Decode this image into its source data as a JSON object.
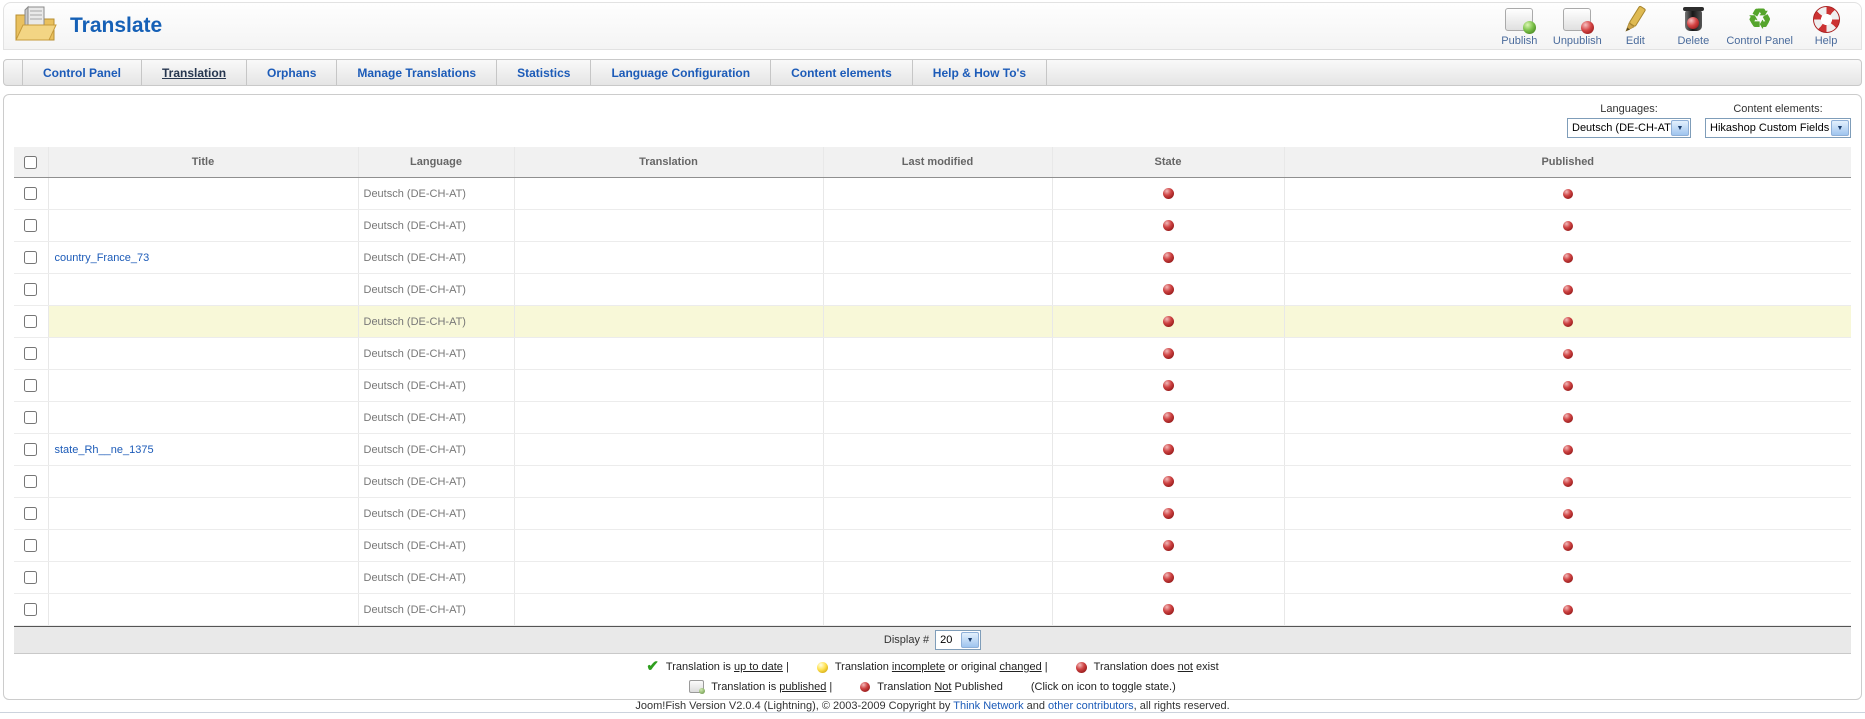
{
  "window": {
    "title": "Translate"
  },
  "toolbar": {
    "buttons": [
      {
        "label": "Publish",
        "icon": "publish-icon"
      },
      {
        "label": "Unpublish",
        "icon": "unpublish-icon"
      },
      {
        "label": "Edit",
        "icon": "edit-icon"
      },
      {
        "label": "Delete",
        "icon": "delete-icon"
      },
      {
        "label": "Control Panel",
        "icon": "control-panel-icon"
      },
      {
        "label": "Help",
        "icon": "help-icon"
      }
    ]
  },
  "tabs": [
    {
      "label": "Control Panel",
      "active": false
    },
    {
      "label": "Translation",
      "active": true
    },
    {
      "label": "Orphans",
      "active": false
    },
    {
      "label": "Manage Translations",
      "active": false
    },
    {
      "label": "Statistics",
      "active": false
    },
    {
      "label": "Language Configuration",
      "active": false
    },
    {
      "label": "Content elements",
      "active": false
    },
    {
      "label": "Help & How To's",
      "active": false
    }
  ],
  "filters": {
    "languages_label": "Languages:",
    "languages_value": "Deutsch (DE-CH-AT)",
    "content_elements_label": "Content elements:",
    "content_elements_value": "Hikashop Custom Fields"
  },
  "table": {
    "columns": [
      "Title",
      "Language",
      "Translation",
      "Last modified",
      "State",
      "Published"
    ],
    "rows": [
      {
        "title": "",
        "language": "Deutsch (DE-CH-AT)",
        "translation": "",
        "last_modified": "",
        "state": "not-exist",
        "published": "no",
        "highlighted": false
      },
      {
        "title": "",
        "language": "Deutsch (DE-CH-AT)",
        "translation": "",
        "last_modified": "",
        "state": "not-exist",
        "published": "no",
        "highlighted": false
      },
      {
        "title": "country_France_73",
        "language": "Deutsch (DE-CH-AT)",
        "translation": "",
        "last_modified": "",
        "state": "not-exist",
        "published": "no",
        "highlighted": false
      },
      {
        "title": "",
        "language": "Deutsch (DE-CH-AT)",
        "translation": "",
        "last_modified": "",
        "state": "not-exist",
        "published": "no",
        "highlighted": false
      },
      {
        "title": "",
        "language": "Deutsch (DE-CH-AT)",
        "translation": "",
        "last_modified": "",
        "state": "not-exist",
        "published": "no",
        "highlighted": true
      },
      {
        "title": "",
        "language": "Deutsch (DE-CH-AT)",
        "translation": "",
        "last_modified": "",
        "state": "not-exist",
        "published": "no",
        "highlighted": false
      },
      {
        "title": "",
        "language": "Deutsch (DE-CH-AT)",
        "translation": "",
        "last_modified": "",
        "state": "not-exist",
        "published": "no",
        "highlighted": false
      },
      {
        "title": "",
        "language": "Deutsch (DE-CH-AT)",
        "translation": "",
        "last_modified": "",
        "state": "not-exist",
        "published": "no",
        "highlighted": false
      },
      {
        "title": "state_Rh__ne_1375",
        "language": "Deutsch (DE-CH-AT)",
        "translation": "",
        "last_modified": "",
        "state": "not-exist",
        "published": "no",
        "highlighted": false
      },
      {
        "title": "",
        "language": "Deutsch (DE-CH-AT)",
        "translation": "",
        "last_modified": "",
        "state": "not-exist",
        "published": "no",
        "highlighted": false
      },
      {
        "title": "",
        "language": "Deutsch (DE-CH-AT)",
        "translation": "",
        "last_modified": "",
        "state": "not-exist",
        "published": "no",
        "highlighted": false
      },
      {
        "title": "",
        "language": "Deutsch (DE-CH-AT)",
        "translation": "",
        "last_modified": "",
        "state": "not-exist",
        "published": "no",
        "highlighted": false
      },
      {
        "title": "",
        "language": "Deutsch (DE-CH-AT)",
        "translation": "",
        "last_modified": "",
        "state": "not-exist",
        "published": "no",
        "highlighted": false
      },
      {
        "title": "",
        "language": "Deutsch (DE-CH-AT)",
        "translation": "",
        "last_modified": "",
        "state": "not-exist",
        "published": "no",
        "highlighted": false
      }
    ]
  },
  "pagination": {
    "label": "Display #",
    "value": "20"
  },
  "legend": {
    "up_to_date": {
      "pre": "Translation is ",
      "u": "up to date",
      "post": " |"
    },
    "incomplete": {
      "pre": "Translation ",
      "u1": "incomplete",
      "mid": " or original ",
      "u2": "changed",
      "post": " |"
    },
    "not_exist": {
      "pre": "Translation does ",
      "u": "not",
      "post": " exist"
    },
    "published": {
      "pre": "Translation is ",
      "u": "published",
      "post": " |"
    },
    "not_published": {
      "pre": "Translation ",
      "u": "Not",
      "post": " Published"
    },
    "toggle_note": "(Click on icon to toggle state.)"
  },
  "footer": {
    "pre": "Joom!Fish Version V2.0.4 (Lightning), © 2003-2009 Copyright by ",
    "link1": "Think Network",
    "mid": " and ",
    "link2": "other contributors",
    "post": ", all rights reserved."
  },
  "colors": {
    "accent_blue": "#1c5bb8",
    "title_blue": "#1560b6",
    "state_red": "#8e1414",
    "check_green": "#2e9e1e",
    "highlight_yellow": "#f8f8d8"
  }
}
